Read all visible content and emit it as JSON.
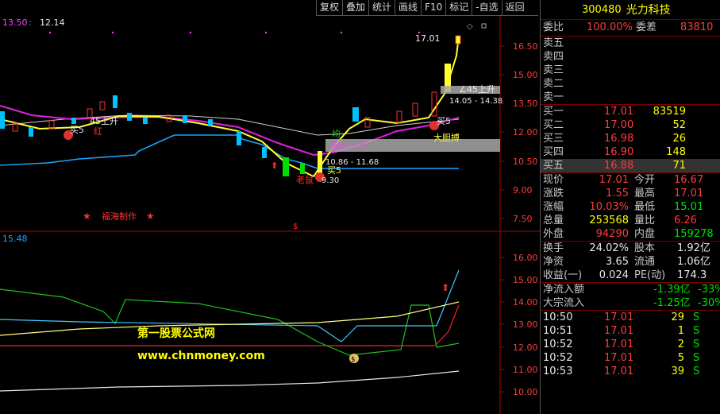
{
  "toolbar": {
    "items": [
      "复权",
      "叠加",
      "统计",
      "画线",
      "F10",
      "标记",
      "-自选",
      "返回"
    ]
  },
  "chart": {
    "header_left": "13.50",
    "header_right": "12.14",
    "y_labels": [
      "16.50",
      "15.00",
      "13.50",
      "12.00",
      "10.50",
      "9.00",
      "7.50"
    ],
    "high_label": "17.01",
    "zone_label_1": "∠45上升",
    "zone_range_1": "14.05 - 14.38",
    "zone_label_2": "阻力上升",
    "zone_range_2": "10.86 - 11.68",
    "signal_buy_1": "买5",
    "signal_buy_2": "买5",
    "signal_buy_3": "买5",
    "signal_45": "45上升",
    "signal_red": "红",
    "signal_big": "大胆搏",
    "signal_low": "老鼠",
    "signal_low_val": "9.30",
    "signal_ma": "均",
    "author": "福海制作",
    "dollar": "$",
    "sub_header": "15.48",
    "sub_y_labels": [
      "16.00",
      "15.00",
      "14.00",
      "13.00",
      "12.00",
      "11.00",
      "10.00"
    ],
    "watermark_1": "第一股票公式网",
    "watermark_2": "www.chnmoney.com"
  },
  "panel": {
    "code": "300480",
    "name": "光力科技",
    "webi_label": "委比",
    "webi": "100.00%",
    "weicha_label": "委差",
    "weicha": "83810",
    "asks": [
      {
        "label": "卖五",
        "price": "",
        "vol": ""
      },
      {
        "label": "卖四",
        "price": "",
        "vol": ""
      },
      {
        "label": "卖三",
        "price": "",
        "vol": ""
      },
      {
        "label": "卖二",
        "price": "",
        "vol": ""
      },
      {
        "label": "卖一",
        "price": "",
        "vol": ""
      }
    ],
    "bids": [
      {
        "label": "买一",
        "price": "17.01",
        "vol": "83519"
      },
      {
        "label": "买二",
        "price": "17.00",
        "vol": "52"
      },
      {
        "label": "买三",
        "price": "16.98",
        "vol": "26"
      },
      {
        "label": "买四",
        "price": "16.90",
        "vol": "148"
      },
      {
        "label": "买五",
        "price": "16.88",
        "vol": "71"
      }
    ],
    "stats": [
      {
        "l1": "现价",
        "v1": "17.01",
        "c1": "red",
        "l2": "今开",
        "v2": "16.67",
        "c2": "red"
      },
      {
        "l1": "涨跌",
        "v1": "1.55",
        "c1": "red",
        "l2": "最高",
        "v2": "17.01",
        "c2": "red"
      },
      {
        "l1": "涨幅",
        "v1": "10.03%",
        "c1": "red",
        "l2": "最低",
        "v2": "15.01",
        "c2": "grn"
      },
      {
        "l1": "总量",
        "v1": "253568",
        "c1": "yel",
        "l2": "量比",
        "v2": "6.26",
        "c2": "red"
      },
      {
        "l1": "外盘",
        "v1": "94290",
        "c1": "red",
        "l2": "内盘",
        "v2": "159278",
        "c2": "grn"
      }
    ],
    "stats2": [
      {
        "l1": "换手",
        "v1": "24.02%",
        "l2": "股本",
        "v2": "1.92亿"
      },
      {
        "l1": "净资",
        "v1": "3.65",
        "l2": "流通",
        "v2": "1.06亿"
      },
      {
        "l1": "收益(一)",
        "v1": "0.024",
        "l2": "PE(动)",
        "v2": "174.3"
      }
    ],
    "flows": [
      {
        "label": "净流入额",
        "v1": "-1.39亿",
        "v2": "-33%"
      },
      {
        "label": "大宗流入",
        "v1": "-1.25亿",
        "v2": "-30%"
      }
    ],
    "ticks": [
      {
        "time": "10:50",
        "price": "17.01",
        "vol": "29",
        "side": "S"
      },
      {
        "time": "10:51",
        "price": "17.01",
        "vol": "1",
        "side": "S"
      },
      {
        "time": "10:52",
        "price": "17.01",
        "vol": "2",
        "side": "S"
      },
      {
        "time": "10:52",
        "price": "17.01",
        "vol": "5",
        "side": "S"
      },
      {
        "time": "10:53",
        "price": "17.01",
        "vol": "39",
        "side": "S"
      }
    ]
  }
}
